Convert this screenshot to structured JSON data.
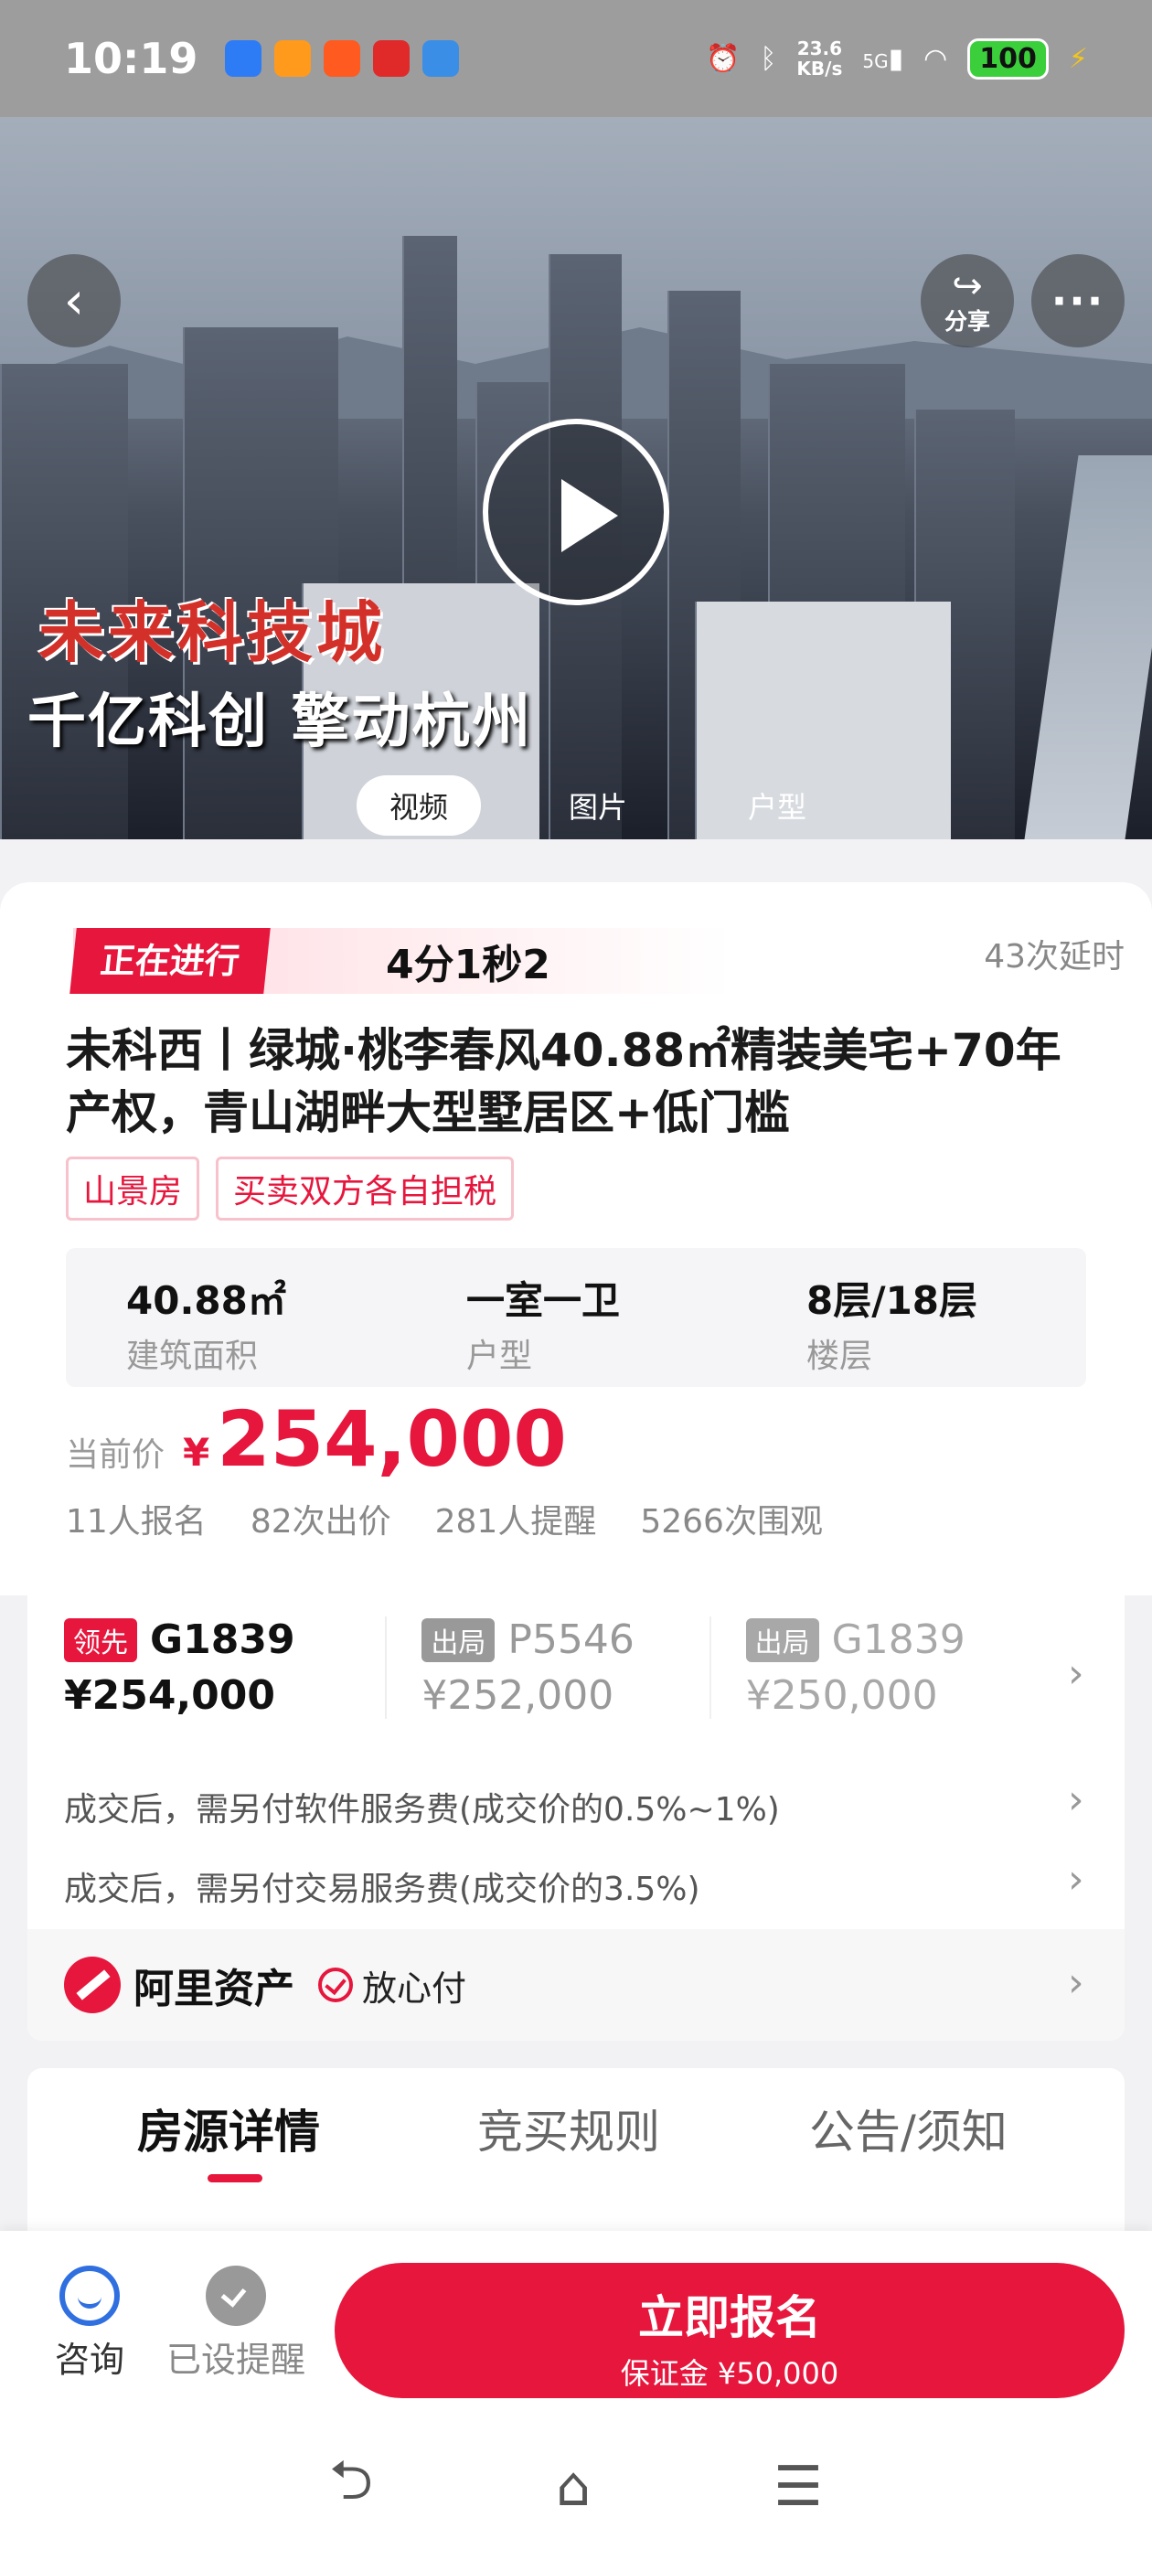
{
  "status_bar": {
    "time": "10:19",
    "speed": "23.6",
    "speed_unit": "KB/s",
    "network": "5G",
    "battery": "100"
  },
  "hero": {
    "slogan_line1": "未来科技城",
    "slogan_line2": "千亿科创 擎动杭州",
    "share_label": "分享",
    "media_tabs": [
      "视频",
      "图片",
      "户型"
    ]
  },
  "auction": {
    "status_tag": "正在进行",
    "countdown": "4分1秒2",
    "delay_count": "43次延时",
    "title": "未科西丨绿城·桃李春风40.88㎡精装美宅+70年产权，青山湖畔大型墅居区+低门槛",
    "tags": [
      "山景房",
      "买卖双方各自担税"
    ],
    "specs": [
      {
        "value": "40.88㎡",
        "label": "建筑面积"
      },
      {
        "value": "一室一卫",
        "label": "户型"
      },
      {
        "value": "8层/18层",
        "label": "楼层"
      }
    ],
    "price_label": "当前价",
    "currency": "¥",
    "current_price": "254,000",
    "stats": [
      "11人报名",
      "82次出价",
      "281人提醒",
      "5266次围观"
    ]
  },
  "bids": [
    {
      "badge": "领先",
      "code": "G1839",
      "price": "¥254,000"
    },
    {
      "badge": "出局",
      "code": "P5546",
      "price": "¥252,000"
    },
    {
      "badge": "出局",
      "code": "G1839",
      "price": "¥250,000"
    }
  ],
  "fees": [
    "成交后，需另付软件服务费(成交价的0.5%~1%)",
    "成交后，需另付交易服务费(成交价的3.5%)"
  ],
  "platform": {
    "name": "阿里资产",
    "guarantee": "放心付"
  },
  "detail_tabs": [
    "房源详情",
    "竞买规则",
    "公告/须知"
  ],
  "action_bar": {
    "consult": "咨询",
    "reminder": "已设提醒",
    "signup": "立即报名",
    "deposit": "保证金 ¥50,000"
  },
  "colors": {
    "accent": "#e6163d",
    "consult_blue": "#2f6fe0"
  }
}
